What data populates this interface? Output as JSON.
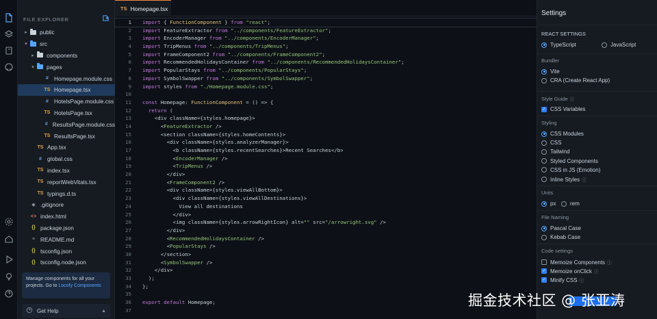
{
  "explorer": {
    "title": "FILE EXPLORER",
    "items": [
      {
        "label": "public",
        "kind": "folder",
        "open": false,
        "depth": 0,
        "active": false
      },
      {
        "label": "src",
        "kind": "folder",
        "open": true,
        "depth": 0,
        "active": false
      },
      {
        "label": "components",
        "kind": "folder",
        "open": false,
        "depth": 1,
        "active": false
      },
      {
        "label": "pages",
        "kind": "folder",
        "open": true,
        "depth": 1,
        "active": false
      },
      {
        "label": "Homepage.module.css",
        "kind": "css",
        "depth": 2,
        "active": false
      },
      {
        "label": "Homepage.tsx",
        "kind": "ts",
        "depth": 2,
        "active": true
      },
      {
        "label": "HotelsPage.module.css",
        "kind": "css",
        "depth": 2,
        "active": false
      },
      {
        "label": "HotelsPage.tsx",
        "kind": "ts",
        "depth": 2,
        "active": false
      },
      {
        "label": "ResultsPage.module.css",
        "kind": "css",
        "depth": 2,
        "active": false
      },
      {
        "label": "ResultsPage.tsx",
        "kind": "ts",
        "depth": 2,
        "active": false
      },
      {
        "label": "App.tsx",
        "kind": "ts",
        "depth": 1,
        "active": false
      },
      {
        "label": "global.css",
        "kind": "css",
        "depth": 1,
        "active": false
      },
      {
        "label": "index.tsx",
        "kind": "ts",
        "depth": 1,
        "active": false
      },
      {
        "label": "reportWebVitals.tsx",
        "kind": "ts",
        "depth": 1,
        "active": false
      },
      {
        "label": "typings.d.ts",
        "kind": "ts",
        "depth": 1,
        "active": false
      },
      {
        "label": ".gitignore",
        "kind": "git",
        "depth": 0,
        "active": false
      },
      {
        "label": "index.html",
        "kind": "html",
        "depth": 0,
        "active": false
      },
      {
        "label": "package.json",
        "kind": "json",
        "depth": 0,
        "active": false
      },
      {
        "label": "README.md",
        "kind": "md",
        "depth": 0,
        "active": false
      },
      {
        "label": "tsconfig.json",
        "kind": "json",
        "depth": 0,
        "active": false
      },
      {
        "label": "tsconfig.node.json",
        "kind": "json",
        "depth": 0,
        "active": false
      }
    ],
    "promo_text": "Manage components for all your projects. Go to",
    "promo_link": "Locofy Components",
    "help_label": "Get Help"
  },
  "badges": {
    "ts": "TS",
    "css": "#",
    "json": "{}",
    "git": "◆",
    "html": "<>",
    "md": "≡"
  },
  "editor": {
    "tab_badge": "TS",
    "tab_label": "Homepage.tsx",
    "current_line": 1,
    "lines": [
      "import { FunctionComponent } from \"react\";",
      "import FeatureExtractor from \"../components/FeatureExtractor\";",
      "import EncoderManager from \"../components/EncoderManager\";",
      "import TripMenus from \"../components/TripMenus\";",
      "import FrameComponent2 from \"../components/FrameComponent2\";",
      "import RecommendedHolidaysContainer from \"../components/RecommendedHolidaysContainer\";",
      "import PopularStays from \"../components/PopularStays\";",
      "import SymbolSwapper from \"../components/SymbolSwapper\";",
      "import styles from \"./Homepage.module.css\";",
      "",
      "const Homepage: FunctionComponent = () => {",
      "  return (",
      "    <div className={styles.homepage}>",
      "      <FeatureExtractor />",
      "      <section className={styles.homeContents}>",
      "        <div className={styles.analyzerManager}>",
      "          <b className={styles.recentSearches}>Recent Searches</b>",
      "          <EncoderManager />",
      "          <TripMenus />",
      "        </div>",
      "        <FrameComponent2 />",
      "        <div className={styles.viewAllBottom}>",
      "          <div className={styles.viewAllDestinations}>",
      "            View all destinations",
      "          </div>",
      "          <img className={styles.arrowRightIcon} alt=\"\" src=\"/arrowright.svg\" />",
      "        </div>",
      "        <RecommendedHolidaysContainer />",
      "        <PopularStays />",
      "      </section>",
      "      <SymbolSwapper />",
      "    </div>",
      "  );",
      "};",
      "",
      "export default Homepage;",
      ""
    ]
  },
  "settings": {
    "title": "Settings",
    "react_settings": {
      "label": "REACT SETTINGS",
      "options": [
        {
          "label": "TypeScript",
          "on": true
        },
        {
          "label": "JavaScript",
          "on": false
        }
      ]
    },
    "bundler": {
      "label": "Bundler",
      "options": [
        {
          "label": "Vite",
          "on": true
        },
        {
          "label": "CRA (Create React App)",
          "on": false
        }
      ]
    },
    "style_guide": {
      "label": "Style Guide",
      "options": [
        {
          "label": "CSS Variables",
          "on": true
        }
      ]
    },
    "styling": {
      "label": "Styling",
      "options": [
        {
          "label": "CSS Modules",
          "on": true
        },
        {
          "label": "CSS",
          "on": false
        },
        {
          "label": "Tailwind",
          "on": false
        },
        {
          "label": "Styled Components",
          "on": false
        },
        {
          "label": "CSS in JS (Emotion)",
          "on": false
        },
        {
          "label": "Inline Styles",
          "on": false
        }
      ]
    },
    "units": {
      "label": "Units",
      "options": [
        {
          "label": "px",
          "on": true
        },
        {
          "label": "rem",
          "on": false
        }
      ]
    },
    "file_naming": {
      "label": "File Naming",
      "options": [
        {
          "label": "Pascal Case",
          "on": true
        },
        {
          "label": "Kebab Case",
          "on": false
        }
      ]
    },
    "code_settings": {
      "label": "Code settings",
      "options": [
        {
          "label": "Memoize Components",
          "on": false
        },
        {
          "label": "Memoize onClick",
          "on": true
        },
        {
          "label": "Minify CSS",
          "on": true
        }
      ]
    },
    "info_glyph": "ⓘ",
    "check_glyph": "✓"
  },
  "watermark": "掘金技术社区 @ 张亚涛",
  "colors": {
    "accent": "#58a6ff",
    "keyword": "#c678dd",
    "tag": "#98c379",
    "string": "#98c379",
    "active_row": "#1f3a5c"
  }
}
